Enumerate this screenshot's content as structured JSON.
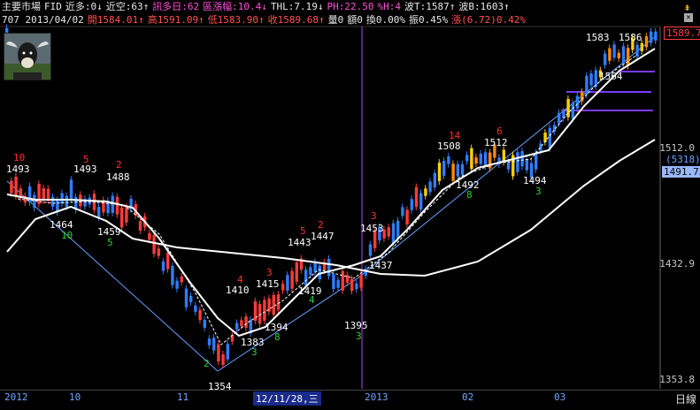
{
  "header": {
    "line1": [
      {
        "text": "主要市場",
        "color": "#e8e8e8"
      },
      {
        "text": "FID",
        "color": "#e8e8e8"
      },
      {
        "text": "近多:0↓",
        "color": "#e8e8e8"
      },
      {
        "text": "近空:63↑",
        "color": "#e8e8e8"
      },
      {
        "text": "訊多日:62",
        "color": "#ff4fd8"
      },
      {
        "text": "區漲幅:10.4↓",
        "color": "#ff4fd8"
      },
      {
        "text": "THL:7.19↓",
        "color": "#e8e8e8"
      },
      {
        "text": "PH:22.50",
        "color": "#ff4fd8"
      },
      {
        "text": "%H:4",
        "color": "#ff4fd8"
      },
      {
        "text": "波T:1587↑",
        "color": "#e8e8e8"
      },
      {
        "text": "波B:1603↑",
        "color": "#e8e8e8"
      }
    ],
    "line2": [
      {
        "text": "707 2013/04/02",
        "color": "#e8e8e8"
      },
      {
        "text": "開1584.01↑",
        "color": "#ff5050"
      },
      {
        "text": "高1591.09↑",
        "color": "#ff5050"
      },
      {
        "text": "低1583.90↑",
        "color": "#ff5050"
      },
      {
        "text": "收1589.68↑",
        "color": "#ff5050"
      },
      {
        "text": "量0",
        "color": "#e8e8e8"
      },
      {
        "text": "額0",
        "color": "#e8e8e8"
      },
      {
        "text": "換0.00%",
        "color": "#e8e8e8"
      },
      {
        "text": "振0.45%",
        "color": "#e8e8e8"
      },
      {
        "text": "漲(6.72)0.42%",
        "color": "#ff5050"
      }
    ]
  },
  "price_axis": {
    "ticks": [
      "1512.0",
      "1432.9",
      "1353.8"
    ],
    "last_price": "1589.7",
    "ma_value": "1491.73",
    "volume_badge": "(5318)"
  },
  "time_axis": {
    "labels": [
      "2012",
      "10",
      "11",
      "2013",
      "02",
      "03"
    ],
    "selected_date": "12/11/28,三",
    "mode": "日線"
  },
  "colors": {
    "up": "#ff3b3b",
    "down": "#2f7dff",
    "bull": "#ffd000",
    "bear": "#00b050",
    "ma": "#ffffff",
    "trend": "#6aa0ff",
    "cursor": "#b040ff"
  },
  "chart_data": {
    "type": "candlestick",
    "price_labels": [
      {
        "text": "1493"
      },
      {
        "text": "1464"
      },
      {
        "text": "1493"
      },
      {
        "text": "1488"
      },
      {
        "text": "1459"
      },
      {
        "text": "1443"
      },
      {
        "text": "1447"
      },
      {
        "text": "1453"
      },
      {
        "text": "1410"
      },
      {
        "text": "1415"
      },
      {
        "text": "1419"
      },
      {
        "text": "1383"
      },
      {
        "text": "1394"
      },
      {
        "text": "1395"
      },
      {
        "text": "1437"
      },
      {
        "text": "1354"
      },
      {
        "text": "1508"
      },
      {
        "text": "1512"
      },
      {
        "text": "1492"
      },
      {
        "text": "1494"
      },
      {
        "text": "1583"
      },
      {
        "text": "1586"
      },
      {
        "text": "1564"
      }
    ],
    "count_labels_red": [
      "10",
      "5",
      "2",
      "5",
      "2",
      "3",
      "4",
      "3",
      "14",
      "6"
    ],
    "count_labels_green": [
      "10",
      "5",
      "2",
      "3",
      "8",
      "3",
      "4",
      "8",
      "3"
    ]
  },
  "logo_alt": "cow"
}
